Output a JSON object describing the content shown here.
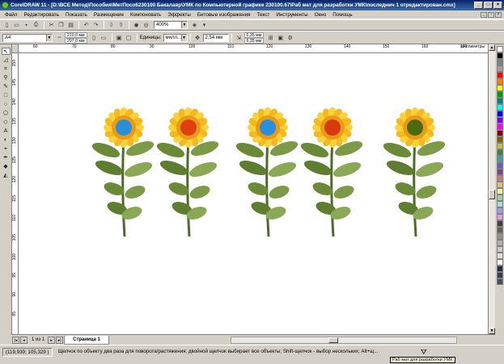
{
  "window": {
    "title": "CorelDRAW 11 - [D:\\ВСЕ Метод\\Пособия\\МетПосо6230100 Бакалавр\\УМК по Компьютерной графике 230100.67\\Раб мат для разработки УМК\\последнич 1 отредактирован.cmx]"
  },
  "menu": {
    "items": [
      "Файл",
      "Редактировать",
      "Показать",
      "Размещение",
      "Компоновать",
      "Эффекты",
      "Битовые изображения",
      "Текст",
      "Инструменты",
      "Окно",
      "Помощь"
    ]
  },
  "toolbar": {
    "zoom_value": "400%"
  },
  "properties": {
    "paper_size": "A4",
    "width": "210,0 мм",
    "height": "297,0 мм",
    "units_label": "Единицы:",
    "units_value": "милл...",
    "nudge": "2,54 мм",
    "dup_x": "6,35 мм",
    "dup_y": "6,35 мм"
  },
  "ruler": {
    "unit_label": "миллиметры",
    "top_ticks": [
      "60",
      "70",
      "80",
      "90",
      "100",
      "110",
      "120",
      "130",
      "140",
      "150",
      "160",
      "170"
    ],
    "left_ticks": [
      "150",
      "145",
      "140",
      "135",
      "130",
      "125",
      "120",
      "115",
      "110",
      "105",
      "100",
      "95",
      "90",
      "85"
    ]
  },
  "page_nav": {
    "count": "1 из 1",
    "tab_label": "Страница 1"
  },
  "status": {
    "coords": "(119,939; 105,329 )",
    "hint": "Щелчок по объекту два раза для поворота/растяжения; двойной щелчок выбирает все объекты; Shift-щелчок - выбор нескольких; Alt+щ...",
    "tooltip": "Раб мат для разработки УМК"
  },
  "palette": {
    "colors": [
      "#ffffff",
      "#000000",
      "#808080",
      "#a0a0a0",
      "#ff0000",
      "#ff8000",
      "#ffff00",
      "#00a000",
      "#008080",
      "#00ffff",
      "#0000ff",
      "#8000ff",
      "#ff00ff",
      "#800000",
      "#806000",
      "#c0c040",
      "#408040",
      "#40a0a0",
      "#6060c0",
      "#804080",
      "#c08080",
      "#e0c080",
      "#f0f0a0",
      "#a0d0a0",
      "#a0e0e0",
      "#a0a0e0",
      "#e0a0e0",
      "#404040",
      "#606060",
      "#909090",
      "#b0b0b0",
      "#c8c8c8",
      "#e0e0e0",
      "#f4f4f4",
      "#203040",
      "#304050",
      "#405060"
    ]
  },
  "flowers": [
    {
      "center_color": "#2a8fd8"
    },
    {
      "center_color": "#e04010"
    },
    {
      "center_color": "#2a8fd8"
    },
    {
      "center_color": "#d83a10"
    },
    {
      "center_color": "#4a6a10"
    }
  ]
}
